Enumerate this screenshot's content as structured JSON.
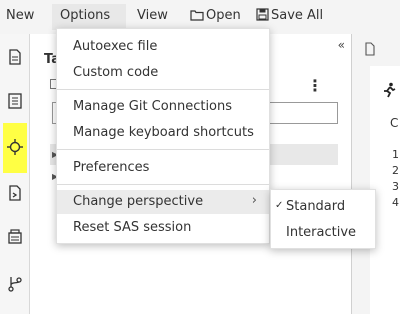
{
  "menubar": {
    "new_label": "New",
    "options_label": "Options",
    "view_label": "View",
    "open_label": "Open",
    "saveall_label": "Save All"
  },
  "pane": {
    "title": "Ta",
    "collapse_glyph": "«",
    "kebab_glyph": "⋮"
  },
  "options_menu": {
    "items": [
      {
        "label": "Autoexec file"
      },
      {
        "label": "Custom code"
      },
      {
        "label": "Manage Git Connections"
      },
      {
        "label": "Manage keyboard shortcuts"
      },
      {
        "label": "Preferences"
      },
      {
        "label": "Change perspective",
        "has_submenu": true
      },
      {
        "label": "Reset SAS session"
      }
    ]
  },
  "perspective_submenu": {
    "items": [
      {
        "label": "Standard",
        "checked": true
      },
      {
        "label": "Interactive",
        "checked": false
      }
    ]
  },
  "right_pane": {
    "tab_letter": "C",
    "line_numbers": [
      "1",
      "2",
      "3",
      "4"
    ]
  },
  "colors": {
    "highlight": "#ffff44",
    "menu_bg": "#ffffff",
    "active_item_bg": "#ebebeb"
  },
  "icons": [
    "folder-icon",
    "save-icon",
    "document-icon",
    "report-icon",
    "snippet-icon",
    "import-icon",
    "libraries-icon",
    "git-icon",
    "runner-icon"
  ]
}
